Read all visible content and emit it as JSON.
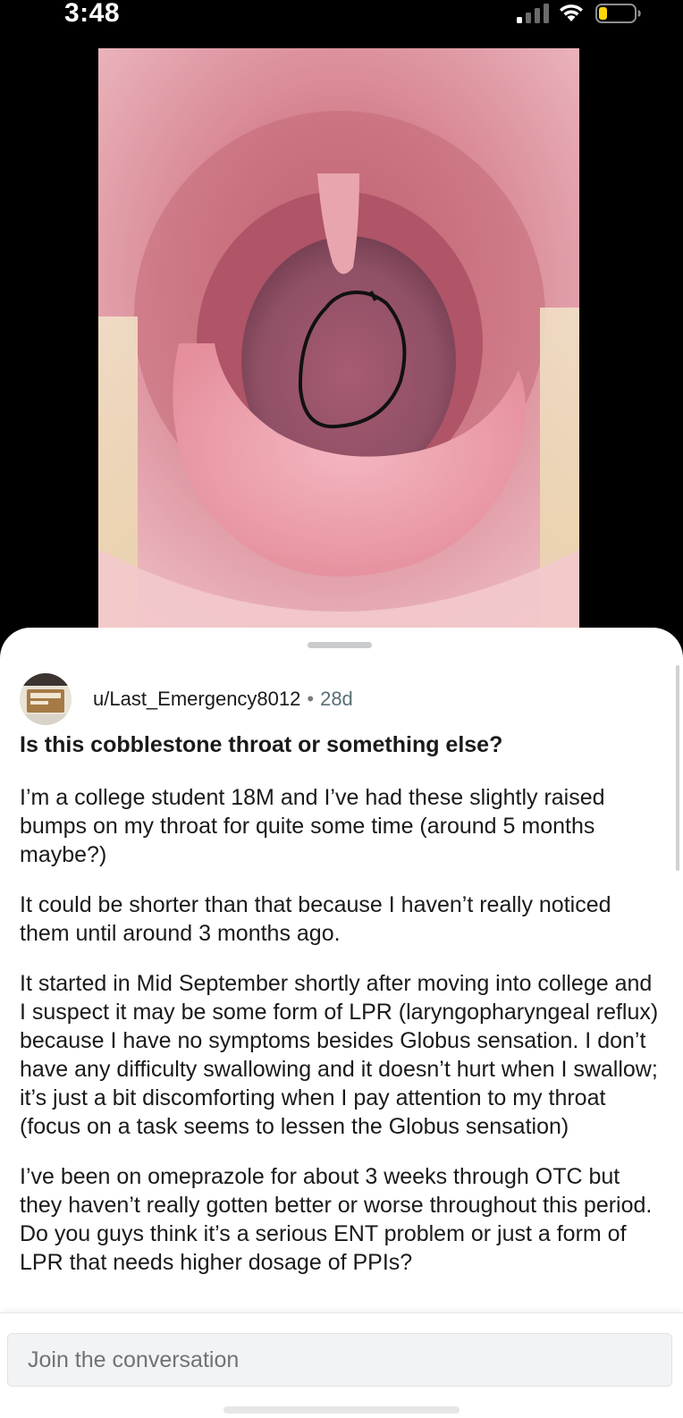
{
  "status_bar": {
    "time": "3:48",
    "icons": [
      "cellular-signal-icon",
      "wifi-icon",
      "battery-icon"
    ]
  },
  "post": {
    "author": "u/Last_Emergency8012",
    "separator": "•",
    "age": "28d",
    "title": "Is this cobblestone throat or something else?",
    "paragraphs": [
      "I’m a college student 18M and I’ve had these slightly raised bumps on my throat for quite some time (around 5 months maybe?)",
      "It could be shorter than that because I haven’t really noticed them until around 3 months ago.",
      "It started in Mid September shortly after moving into college and I suspect it may be some form of LPR (laryngopharyngeal reflux) because I have no symptoms besides Globus sensation. I don’t have any difficulty swallowing and it doesn’t hurt when I swallow; it’s just a bit discomforting when I pay attention to my throat (focus on a task seems to lessen the Globus sensation)",
      "I’ve been on omeprazole for about 3 weeks through OTC but they haven’t really gotten better or worse throughout this period. Do you guys think it’s a serious ENT problem or just a form of LPR that needs higher dosage of PPIs?"
    ]
  },
  "composer": {
    "placeholder": "Join the conversation"
  },
  "colors": {
    "background": "#000000",
    "sheet": "#ffffff",
    "text": "#1a1a1b",
    "meta": "#576f76",
    "input_bg": "#f2f3f5"
  }
}
